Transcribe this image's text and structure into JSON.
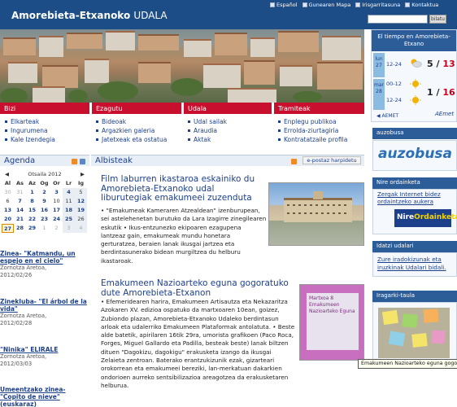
{
  "header": {
    "logo_main": "Amorebieta-Etxanoko",
    "logo_sub": "UDALA",
    "links": [
      "Español",
      "Gunearen Mapa",
      "Irisgarritasuna",
      "Kontaktua"
    ],
    "search_placeholder": "",
    "search_button": "bilatu"
  },
  "weather": {
    "title": "El tiempo en Amorebieta-Etxano",
    "days": [
      {
        "day": "lun",
        "date": "27",
        "periods": [
          "12-24"
        ],
        "low": "5",
        "high": "13",
        "icon": "sun-cloud-icon"
      },
      {
        "day": "mar",
        "date": "28",
        "periods": [
          "00-12",
          "12-24"
        ],
        "low": "1",
        "high": "16",
        "icon": "sun-icon"
      }
    ],
    "sep": "/",
    "aemet": "AEMET",
    "aemet_logo": "AEmet"
  },
  "nav": {
    "sections": [
      {
        "title": "Bizi",
        "items": [
          "Elkarteak",
          "Ingurumena",
          "Kale Izendegia"
        ]
      },
      {
        "title": "Ezagutu",
        "items": [
          "Bideoak",
          "Argazkien galeria",
          "Jatetxeak eta ostatua"
        ]
      },
      {
        "title": "Udala",
        "items": [
          "Udal sailak",
          "Araudia",
          "Aktak"
        ]
      },
      {
        "title": "Tramiteak",
        "items": [
          "Enplegu publikoa",
          "Erroldа-ziurtagiria",
          "Kontratatzaile profila"
        ]
      }
    ]
  },
  "agenda": {
    "title": "Agenda",
    "month": "Otsaila 2012",
    "weekdays": [
      "Al",
      "As",
      "Az",
      "Og",
      "Or",
      "Lr",
      "Ig"
    ],
    "days": [
      "30",
      "31",
      "1",
      "2",
      "3",
      "4",
      "5",
      "6",
      "7",
      "8",
      "9",
      "10",
      "11",
      "12",
      "13",
      "14",
      "15",
      "16",
      "17",
      "18",
      "19",
      "20",
      "21",
      "22",
      "23",
      "24",
      "25",
      "26",
      "27",
      "28",
      "29",
      "1",
      "2",
      "3",
      "4"
    ],
    "events": [
      {
        "title": "Zinea- \"Katmandu, un espejo en el cielo\"",
        "place": "Zornotza Aretoa,",
        "date": "2012/02/26"
      },
      {
        "title": "Zinekluba- \"El árbol de la vida\"",
        "place": "Zornotza Aretoa,",
        "date": "2012/02/28"
      },
      {
        "title": "\"Ninika\" ELIRALE",
        "place": "Zornotza Aretoa,",
        "date": "2012/03/03"
      },
      {
        "title": "Umeentzako zinea- \"Copito de nieve\" (euskaraz)",
        "place": "",
        "date": ""
      }
    ]
  },
  "main": {
    "title": "Albisteak",
    "email_button": "e-postaz harpidetu",
    "news": [
      {
        "headline": "Film laburren ikastaroa eskainiko du Amorebieta-Etxanoko udal liburutegiak emakumeei zuzenduta",
        "body": "• \"Emakumeak Kameraren Atzealdean\" izenburupean, sei astelehenetan burutuko da Lara Izagirre zinegilearen eskutik • Ikus-entzunezko ekipoaren ezagupena lantzeaz gain, emakumeak mundu honetara gerturatzea, beraien lanak ikusgai jartzea eta berdintasunerako bidean murgiltzea du helburu ikastaroak."
      },
      {
        "headline": "Emakumeen Nazioarteko eguna gogoratuko dute Amorebieta-Etxanon",
        "body": "• Efemeridearen harira, Emakumeen Artisautza eta Nekazaritza Azokaren XV. edizioa ospatuko da martxoaren 10ean, goizez, Zubiondo plazan, Amorebieta-Etxanoko Udaleko berdintasun arloak eta udalerriko Emakumeen Plataformak antolatuta. • Beste alde batetik, apirilaren 16tik 29ra, umorista grafikoen (Paco Roca, Forges, Miguel Gallardo eta Padilla, besteak beste) lanak biltzen dituen \"Dagokizu, dagokigu\" erakusketa izango da ikusgai Zelaieta zentroan. Baterako erantzukizunik ezak, gizarteari orokorrean eta emakumeei bereziki, lan-merkatuan dakarkien ondorioen aurreko sentsibilizazioa areagotzea da erakusketaren helburua."
      }
    ],
    "poster_text": "Martxoa 8 Emakumeen Nazioarteko Eguna"
  },
  "right": {
    "auzobusa_header": "auzobusa",
    "auzobusa_logo": "auzobusa",
    "ordainketa_header": "Nire ordainketa",
    "ordainketa_link": "Zergak Internet bidez ordaintzeko aukera",
    "ordainketa_logo_a": "Nire",
    "ordainketa_logo_b": "Ordainketa",
    "udalari_header": "Idatzi udalari",
    "udalari_link": "Zure iradokizunak eta iruzkinak Udalari bidali.",
    "iragarki_header": "Iragarki-taula"
  },
  "tooltip": "Emakumeen Nazioarteko eguna gogoratuko",
  "colors": {
    "brand_blue": "#1d4d86",
    "nav_red": "#c8102e",
    "link": "#1c3f8c",
    "temp_high": "#c8001d"
  }
}
